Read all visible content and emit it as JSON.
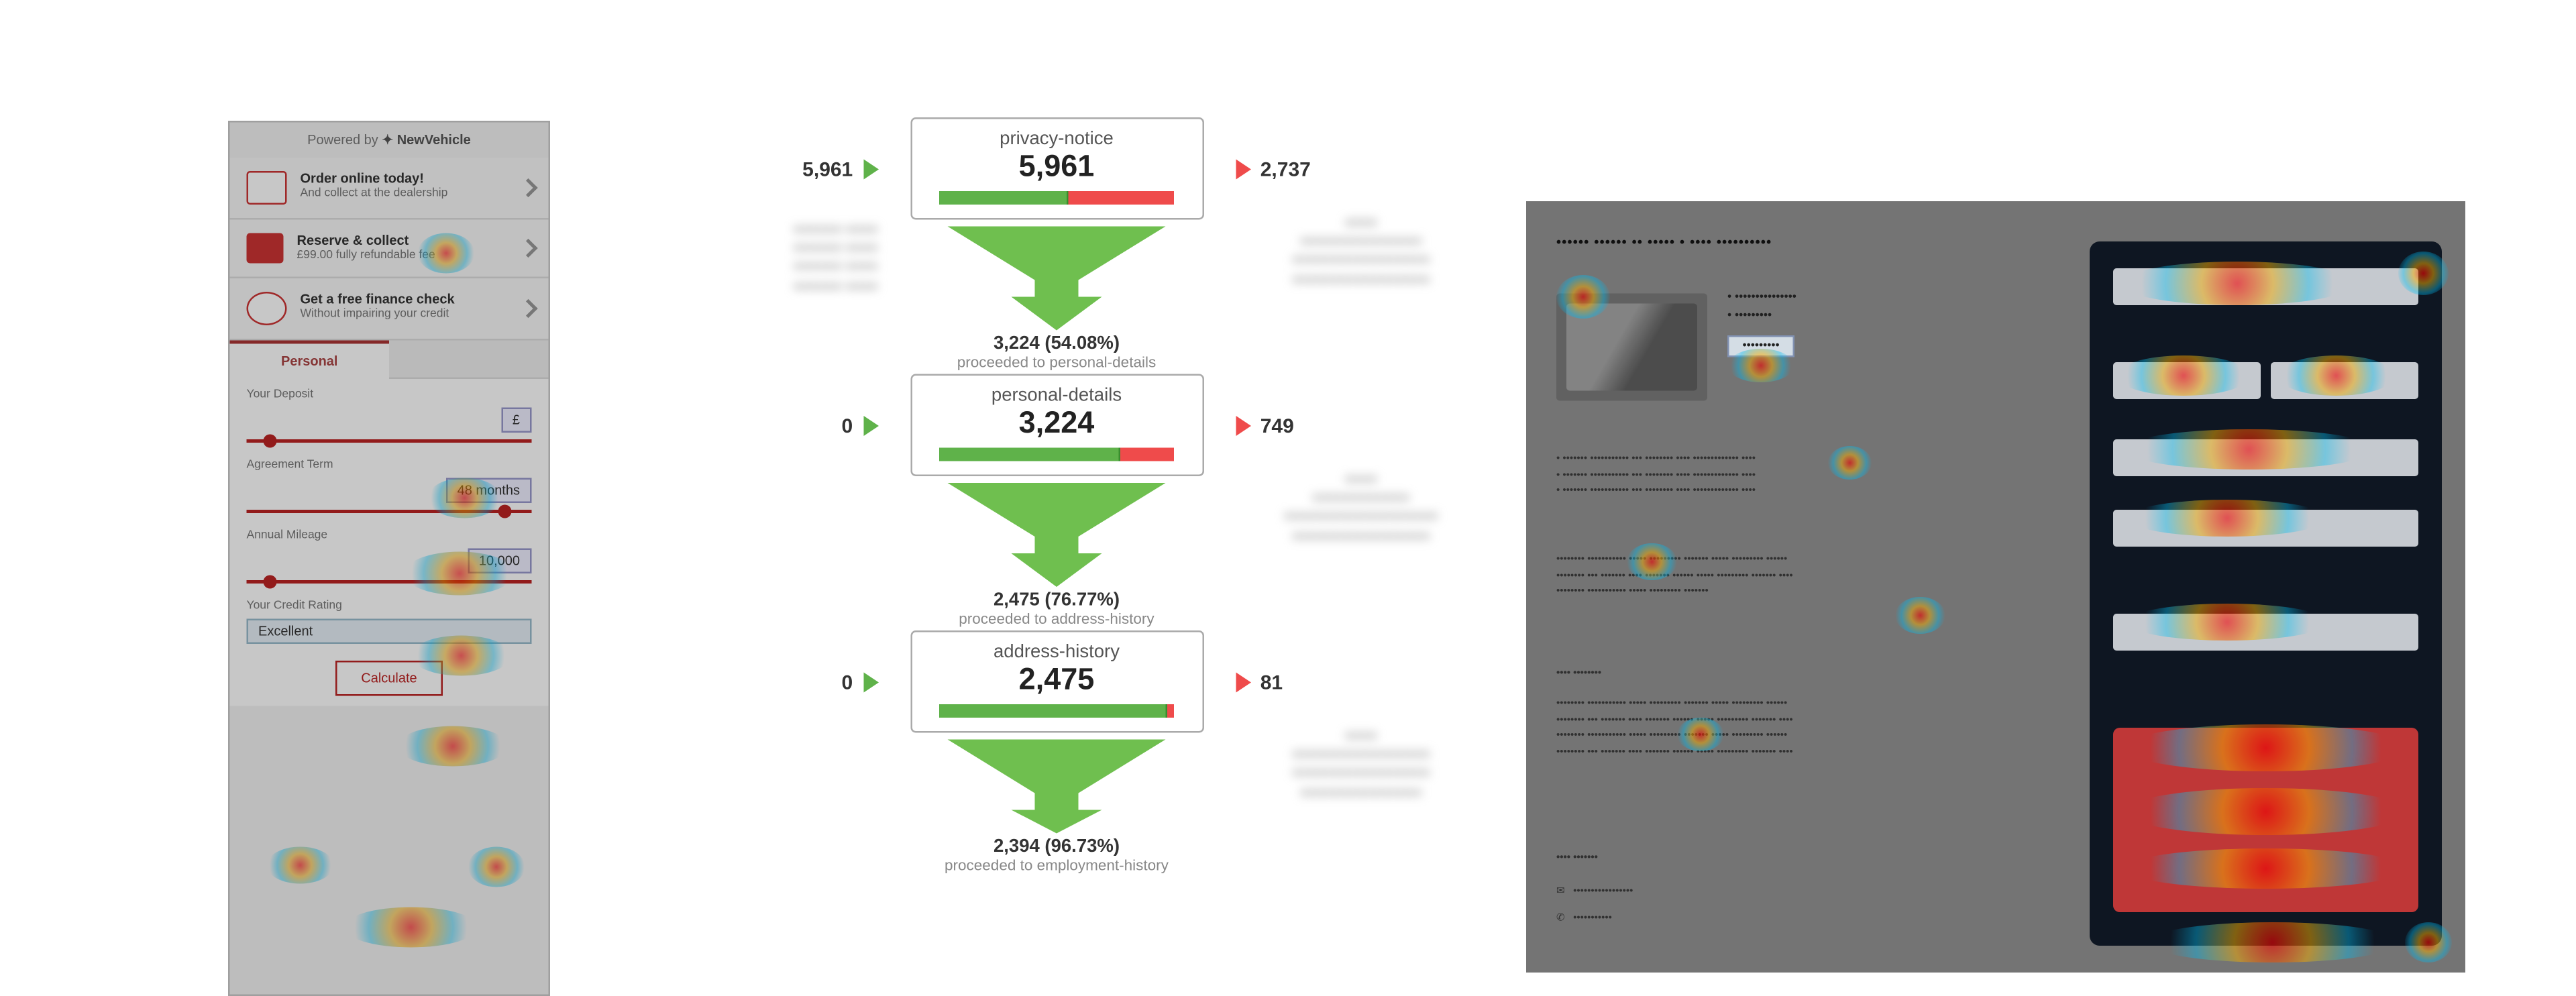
{
  "left_panel": {
    "powered_by_prefix": "Powered by",
    "powered_by_brand": "NewVehicle",
    "cards": [
      {
        "title": "Order online today!",
        "subtitle": "And collect at the dealership"
      },
      {
        "title": "Reserve & collect",
        "subtitle": "£99.00 fully refundable fee"
      },
      {
        "title": "Get a free finance check",
        "subtitle": "Without impairing your credit"
      }
    ],
    "tabs": {
      "active": "Personal",
      "other": ""
    },
    "form": {
      "deposit_label": "Your Deposit",
      "deposit_value": "£",
      "term_label": "Agreement Term",
      "term_value": "48 months",
      "mileage_label": "Annual Mileage",
      "mileage_value": "10,000",
      "credit_label": "Your Credit Rating",
      "credit_value": "Excellent",
      "button": "Calculate"
    }
  },
  "chart_data": {
    "type": "funnel",
    "steps": [
      {
        "name": "privacy-notice",
        "count": 5961,
        "count_fmt": "5,961",
        "entries": 5961,
        "entries_fmt": "5,961",
        "exits": 2737,
        "exits_fmt": "2,737",
        "proceed_count": 3224,
        "proceed_pct": 54.08,
        "proceed_line": "3,224 (54.08%)",
        "proceed_sub": "proceeded to personal-details",
        "bar_green_pct": 54.08
      },
      {
        "name": "personal-details",
        "count": 3224,
        "count_fmt": "3,224",
        "entries": 0,
        "entries_fmt": "0",
        "exits": 749,
        "exits_fmt": "749",
        "proceed_count": 2475,
        "proceed_pct": 76.77,
        "proceed_line": "2,475 (76.77%)",
        "proceed_sub": "proceeded to address-history",
        "bar_green_pct": 76.77
      },
      {
        "name": "address-history",
        "count": 2475,
        "count_fmt": "2,475",
        "entries": 0,
        "entries_fmt": "0",
        "exits": 81,
        "exits_fmt": "81",
        "proceed_count": 2394,
        "proceed_pct": 96.73,
        "proceed_line": "2,394 (96.73%)",
        "proceed_sub": "proceeded to employment-history",
        "bar_green_pct": 96.73
      }
    ]
  }
}
